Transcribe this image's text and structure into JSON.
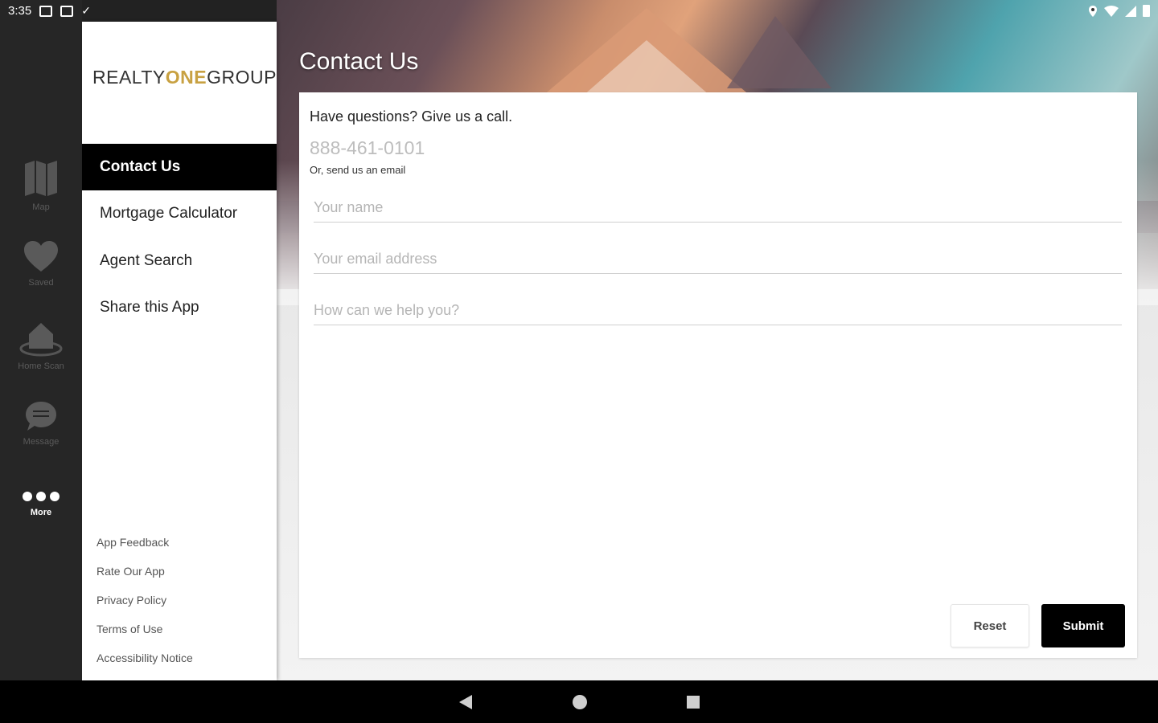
{
  "status_bar": {
    "time": "3:35"
  },
  "tabbar": {
    "tabs": [
      {
        "label": "Map",
        "icon": "map-icon"
      },
      {
        "label": "Saved",
        "icon": "heart-icon"
      },
      {
        "label": "Home Scan",
        "icon": "home-scan-icon"
      },
      {
        "label": "Message",
        "icon": "chat-bubble-icon"
      },
      {
        "label": "More",
        "icon": "more-dots-icon",
        "active": true
      }
    ]
  },
  "drawer": {
    "logo": {
      "part1": "REALTY",
      "part2": "ONE",
      "part3": "GROUP"
    },
    "menu": [
      {
        "label": "Contact Us",
        "active": true
      },
      {
        "label": "Mortgage Calculator"
      },
      {
        "label": "Agent Search"
      },
      {
        "label": "Share this App"
      }
    ],
    "footer_links": [
      "App Feedback",
      "Rate Our App",
      "Privacy Policy",
      "Terms of Use",
      "Accessibility Notice"
    ]
  },
  "main": {
    "title": "Contact Us",
    "question": "Have questions? Give us a call.",
    "phone": "888-461-0101",
    "email_note": "Or, send us an email",
    "fields": {
      "name_placeholder": "Your name",
      "email_placeholder": "Your email address",
      "message_placeholder": "How can we help you?"
    },
    "buttons": {
      "reset": "Reset",
      "submit": "Submit"
    }
  },
  "colors": {
    "brand_gold": "#c8a142",
    "tabbar_bg": "#262626",
    "active_bg": "#000000"
  }
}
